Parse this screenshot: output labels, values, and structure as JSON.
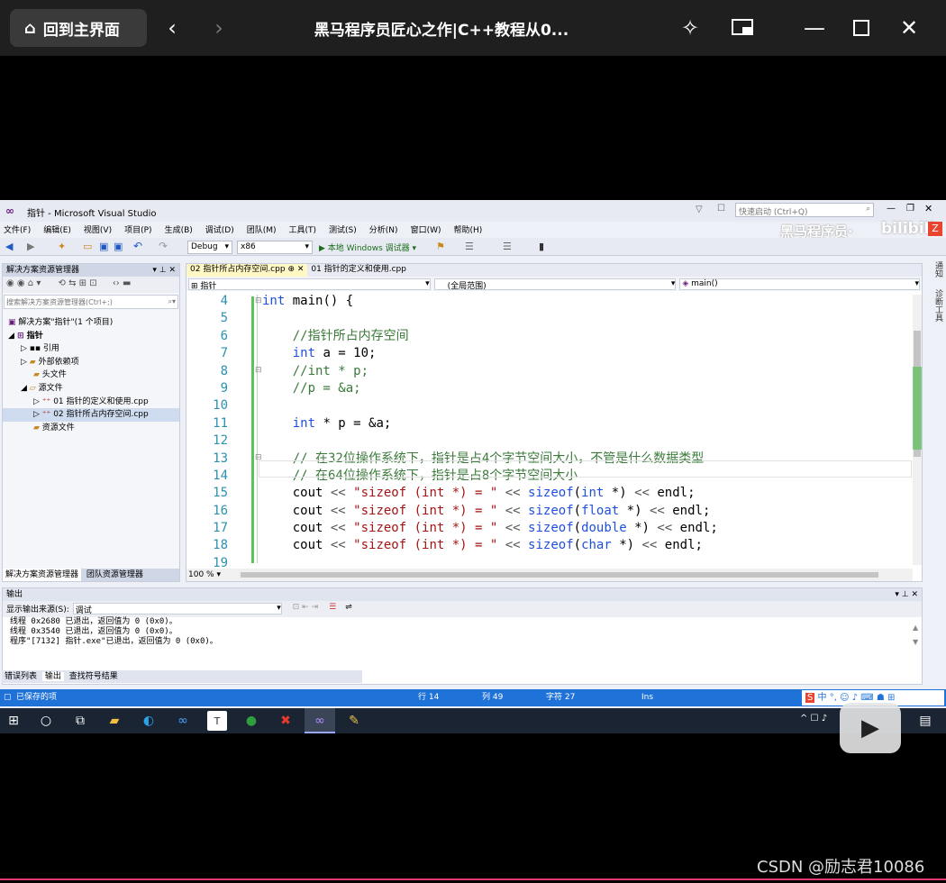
{
  "player": {
    "home_label": "回到主界面",
    "title": "黑马程序员匠心之作|C++教程从0...",
    "back_icon": "chevron-left-icon",
    "forward_icon": "chevron-right-icon"
  },
  "vs": {
    "window_title": "指针 - Microsoft Visual Studio",
    "quick_launch_placeholder": "快速启动 (Ctrl+Q)",
    "menu": [
      "文件(F)",
      "编辑(E)",
      "视图(V)",
      "项目(P)",
      "生成(B)",
      "调试(D)",
      "团队(M)",
      "工具(T)",
      "测试(S)",
      "分析(N)",
      "窗口(W)",
      "帮助(H)"
    ],
    "config": "Debug",
    "platform": "x86",
    "run_label": "▶ 本地 Windows 调试器 ▾",
    "brand": "黑马程序员·",
    "solution_explorer": {
      "title": "解决方案资源管理器",
      "search_placeholder": "搜索解决方案资源管理器(Ctrl+;)",
      "solution": "解决方案\"指针\"(1 个项目)",
      "project": "指针",
      "refs": "引用",
      "external": "外部依赖项",
      "headers": "头文件",
      "sources": "源文件",
      "file1": "01 指针的定义和使用.cpp",
      "file2": "02 指针所占内存空间.cpp",
      "resources": "资源文件",
      "tab_solution": "解决方案资源管理器",
      "tab_team": "团队资源管理器"
    },
    "editor": {
      "tab_active": "02 指针所占内存空间.cpp",
      "tab_other": "01 指针的定义和使用.cpp",
      "nav_project": "指针",
      "nav_scope": "(全局范围)",
      "nav_func": "main()",
      "zoom": "100 %",
      "lines": [
        {
          "n": "4",
          "html": "<span class='kw'>int</span> main() {"
        },
        {
          "n": "5",
          "html": ""
        },
        {
          "n": "6",
          "html": "    <span class='cm'>//指针所占内存空间</span>"
        },
        {
          "n": "7",
          "html": "    <span class='kw'>int</span> a = 10;"
        },
        {
          "n": "8",
          "html": "    <span class='cm'>//int * p;</span>"
        },
        {
          "n": "9",
          "html": "    <span class='cm'>//p = &amp;a;</span>"
        },
        {
          "n": "10",
          "html": ""
        },
        {
          "n": "11",
          "html": "    <span class='kw'>int</span> * p = &amp;a;"
        },
        {
          "n": "12",
          "html": ""
        },
        {
          "n": "13",
          "html": "    <span class='cm'>// 在32位操作系统下，指针是占4个字节空间大小，不管是什么数据类型</span>"
        },
        {
          "n": "14",
          "html": "    <span class='cm'>// 在64位操作系统下，指针是占8个字节空间大小</span>"
        },
        {
          "n": "15",
          "html": "    cout <span class='op'>&lt;&lt;</span> <span class='str'>\"sizeof (int *) = \"</span> <span class='op'>&lt;&lt;</span> <span class='kw'>sizeof</span>(<span class='kw'>int</span> *) <span class='op'>&lt;&lt;</span> endl;"
        },
        {
          "n": "16",
          "html": "    cout <span class='op'>&lt;&lt;</span> <span class='str'>\"sizeof (int *) = \"</span> <span class='op'>&lt;&lt;</span> <span class='kw'>sizeof</span>(<span class='kw'>float</span> *) <span class='op'>&lt;&lt;</span> endl;"
        },
        {
          "n": "17",
          "html": "    cout <span class='op'>&lt;&lt;</span> <span class='str'>\"sizeof (int *) = \"</span> <span class='op'>&lt;&lt;</span> <span class='kw'>sizeof</span>(<span class='kw'>double</span> *) <span class='op'>&lt;&lt;</span> endl;"
        },
        {
          "n": "18",
          "html": "    cout <span class='op'>&lt;&lt;</span> <span class='str'>\"sizeof (int *) = \"</span> <span class='op'>&lt;&lt;</span> <span class='kw'>sizeof</span>(<span class='kw'>char</span> *) <span class='op'>&lt;&lt;</span> endl;"
        },
        {
          "n": "19",
          "html": ""
        }
      ]
    },
    "output": {
      "title": "输出",
      "source_label": "显示输出来源(S):",
      "source_value": "调试",
      "lines": [
        "线程 0x2680 已退出，返回值为 0 (0x0)。",
        "线程 0x3540 已退出，返回值为 0 (0x0)。",
        "程序\"[7132] 指针.exe\"已退出，返回值为 0 (0x0)。"
      ],
      "tab_errors": "错误列表",
      "tab_output": "输出",
      "tab_find": "查找符号结果"
    },
    "status": {
      "saved": "已保存的项",
      "line": "行 14",
      "col": "列 49",
      "char": "字符 27",
      "mode": "Ins"
    },
    "right_rail": [
      "通知",
      "诊断工具"
    ]
  },
  "watermark": "CSDN @励志君10086"
}
